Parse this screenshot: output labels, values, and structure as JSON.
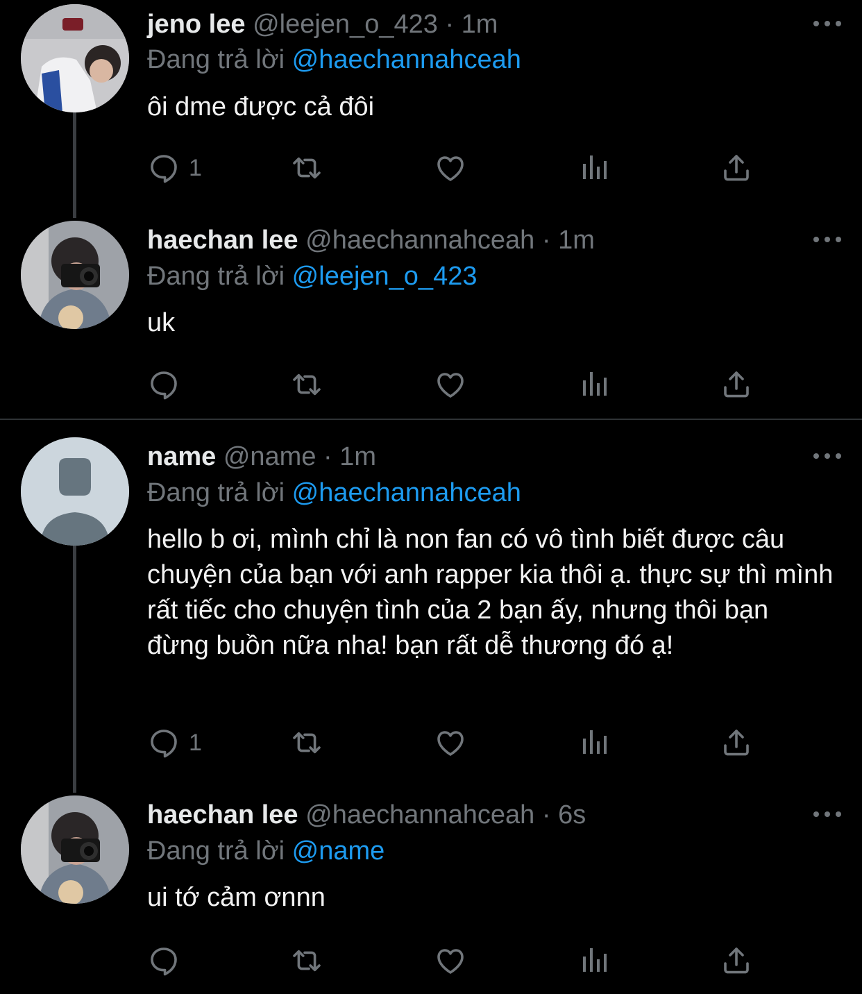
{
  "tweets": [
    {
      "name": "jeno lee",
      "handle": "@leejen_o_423",
      "sep": "·",
      "time": "1m",
      "replying_label": "Đang trả lời",
      "replying_to": "@haechannahceah",
      "body": "ôi dme được cả đôi",
      "reply_count": "1"
    },
    {
      "name": "haechan lee",
      "handle": "@haechannahceah",
      "sep": "·",
      "time": "1m",
      "replying_label": "Đang trả lời",
      "replying_to": "@leejen_o_423",
      "body": "uk",
      "reply_count": ""
    },
    {
      "name": "name",
      "handle": "@name",
      "sep": "·",
      "time": "1m",
      "replying_label": "Đang trả lời",
      "replying_to": "@haechannahceah",
      "body": "hello b ơi, mình chỉ là non fan có vô tình biết được câu chuyện của bạn với anh rapper kia thôi ạ. thực sự thì mình rất tiếc cho chuyện tình của 2 bạn ấy, nhưng thôi bạn đừng buồn nữa nha! bạn rất dễ thương đó ạ!",
      "reply_count": "1"
    },
    {
      "name": "haechan lee",
      "handle": "@haechannahceah",
      "sep": "·",
      "time": "6s",
      "replying_label": "Đang trả lời",
      "replying_to": "@name",
      "body": "ui tớ cảm ơnnn",
      "reply_count": ""
    }
  ],
  "colors": {
    "background": "#000000",
    "accent": "#1d9bf0",
    "muted": "#71767b",
    "text": "#e7e9ea"
  }
}
